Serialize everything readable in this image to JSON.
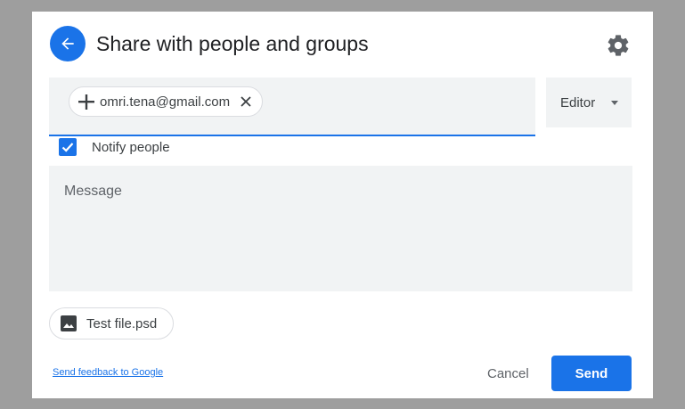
{
  "dialog": {
    "title": "Share with people and groups"
  },
  "recipients": [
    {
      "email": "omri.tena@gmail.com"
    }
  ],
  "role": {
    "selected": "Editor"
  },
  "notify": {
    "label": "Notify people",
    "checked": true
  },
  "message": {
    "placeholder": "Message",
    "value": ""
  },
  "attachment": {
    "file_name": "Test file.psd"
  },
  "footer": {
    "feedback_link": "Send feedback to Google",
    "cancel_label": "Cancel",
    "send_label": "Send"
  },
  "icons": {
    "back": "arrow-left-icon",
    "settings": "gear-icon",
    "contact": "person-icon",
    "remove": "close-icon",
    "checkbox": "check-icon",
    "file": "image-icon"
  },
  "colors": {
    "accent": "#1a73e8",
    "field_background": "#f1f3f4",
    "backdrop": "#9e9e9e"
  }
}
